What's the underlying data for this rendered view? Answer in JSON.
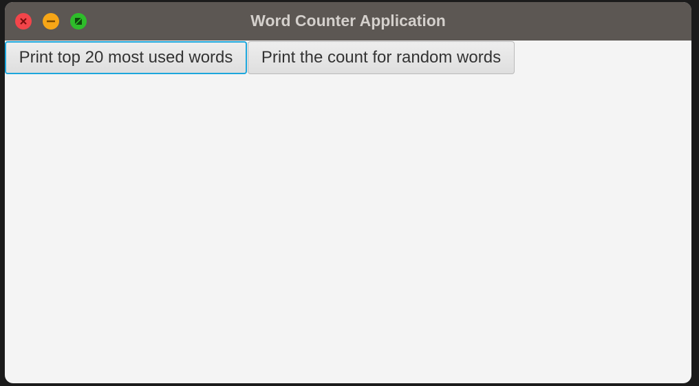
{
  "window": {
    "title": "Word Counter Application"
  },
  "buttons": {
    "top20": "Print top 20 most used words",
    "random_count": "Print the count for random words"
  },
  "colors": {
    "titlebar": "#5c5753",
    "focus_ring": "#1ba6dc",
    "close": "#f2454a",
    "minimize": "#f6a617",
    "maximize": "#2ebd2a"
  }
}
